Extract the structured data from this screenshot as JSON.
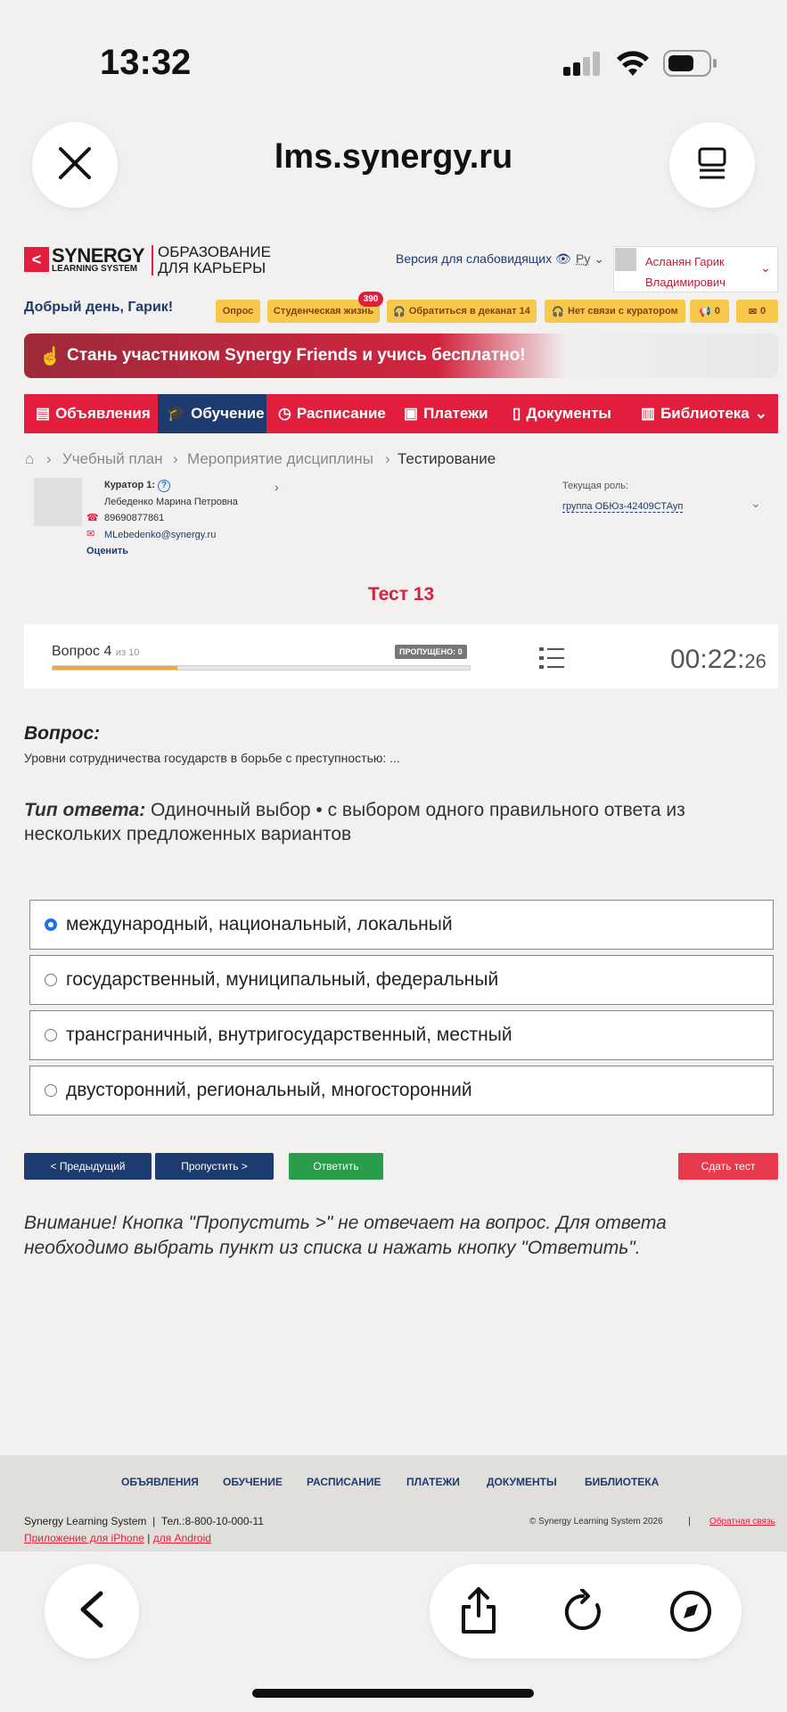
{
  "status": {
    "time": "13:32"
  },
  "browser": {
    "url": "lms.synergy.ru"
  },
  "logo": {
    "brand": "SYNERGY",
    "sub": "LEARNING SYSTEM",
    "edu1": "ОБРАЗОВАНИЕ",
    "edu2": "ДЛЯ КАРЬЕРЫ"
  },
  "header": {
    "accessibility": "Версия для слабовидящих",
    "lang": "Ру",
    "user_line1": "Асланян Гарик",
    "user_line2": "Владимирович",
    "greeting": "Добрый день, Гарик!"
  },
  "pills": {
    "survey": "Опрос",
    "student_life": "Студенческая жизнь",
    "student_badge": "390",
    "dean": "Обратиться в деканат 14",
    "curator": "Нет связи с куратором",
    "notif_count": "0",
    "mail_count": "0"
  },
  "banner": {
    "text": "Стань участником Synergy Friends и учись бесплатно!"
  },
  "nav": {
    "items": [
      "Объявления",
      "Обучение",
      "Расписание",
      "Платежи",
      "Документы",
      "Библиотека"
    ]
  },
  "breadcrumb": {
    "items": [
      "Учебный план",
      "Мероприятие дисциплины",
      "Тестирование"
    ]
  },
  "curator": {
    "label": "Куратор 1:",
    "help": "?",
    "name": "Лебеденко Марина Петровна",
    "phone": "89690877861",
    "email": "MLebedenko@synergy.ru",
    "rate": "Оценить"
  },
  "role": {
    "label": "Текущая роль:",
    "value": "группа ОБЮз-42409СТАуп"
  },
  "test": {
    "title": "Тест 13",
    "question_label": "Вопрос 4",
    "question_of": "из 10",
    "progress": 0.3,
    "skipped": "ПРОПУЩЕНО: 0",
    "timer_main": "00:22:",
    "timer_sec": "26"
  },
  "question": {
    "heading": "Вопрос:",
    "text": "Уровни сотрудничества государств в борьбе с преступностью: ...",
    "type_label": "Тип ответа:",
    "type_text": "Одиночный выбор • с выбором одного правильного ответа из нескольких предложенных вариантов"
  },
  "options": [
    {
      "text": "международный, национальный, локальный",
      "selected": true
    },
    {
      "text": "государственный, муниципальный, федеральный",
      "selected": false
    },
    {
      "text": "трансграничный, внутригосударственный, местный",
      "selected": false
    },
    {
      "text": "двусторонний, региональный, многосторонний",
      "selected": false
    }
  ],
  "buttons": {
    "prev": "< Предыдущий",
    "skip": "Пропустить >",
    "answer": "Ответить",
    "submit": "Сдать тест"
  },
  "notice": "Внимание! Кнопка \"Пропустить >\" не отвечает на вопрос. Для ответа необходимо выбрать пункт из списка и нажать кнопку \"Ответить\".",
  "footer": {
    "nav": [
      "ОБЪЯВЛЕНИЯ",
      "ОБУЧЕНИЕ",
      "РАСПИСАНИЕ",
      "ПЛАТЕЖИ",
      "ДОКУМЕНТЫ",
      "БИБЛИОТЕКА"
    ],
    "company": "Synergy Learning System",
    "phone": "Тел.:8-800-10-000-11",
    "copyright": "© Synergy Learning System 2026",
    "feedback": "Обратная связь",
    "app_ios": "Приложение для iPhone",
    "app_android": "для Android"
  },
  "colors": {
    "brand_red": "#e31e3c",
    "brand_blue": "#1d3b6e",
    "answer_green": "#2a9d4a",
    "pill_yellow": "#f6c94a"
  }
}
